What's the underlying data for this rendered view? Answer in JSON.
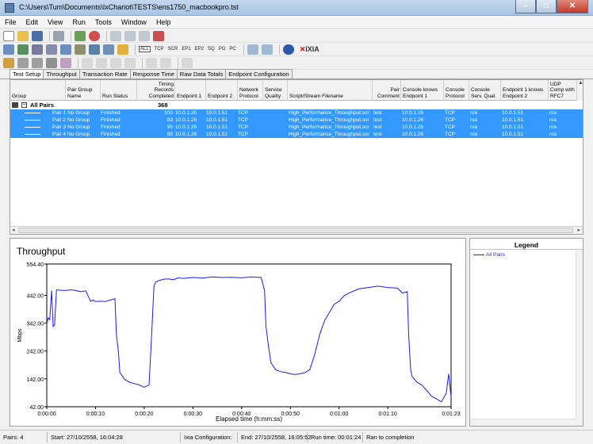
{
  "window": {
    "title": "C:\\Users\\Tum\\Documents\\IxChariot\\TESTS\\ens1750_macbookpro.tst"
  },
  "menu": [
    "File",
    "Edit",
    "View",
    "Run",
    "Tools",
    "Window",
    "Help"
  ],
  "toolbar2_labels": [
    "ALL",
    "TCP",
    "SCR",
    "EP1",
    "EP2",
    "SQ",
    "PG",
    "PC"
  ],
  "brand": "IXIA",
  "tabs": [
    "Test Setup",
    "Throughput",
    "Transaction Rate",
    "Response Time",
    "Raw Data Totals",
    "Endpoint Configuration"
  ],
  "grid": {
    "columns": [
      "Group",
      "Pair Group Name",
      "Run Status",
      "Timing Records Completed",
      "Endpoint 1",
      "Endpoint 2",
      "Network Protocol",
      "Service Quality",
      "Script/Stream Filename",
      "Pair Comment",
      "Console knows Endpoint 1",
      "Console Protocol",
      "Console Serv. Qual.",
      "Endpoint 1 knows Endpoint 2",
      "UDP Comp with RFC7"
    ],
    "all_pairs_label": "All Pairs",
    "all_pairs_total": "368",
    "rows": [
      {
        "pair": "Pair 1",
        "group": "No Group",
        "status": "Finished",
        "records": "100",
        "ep1": "10.0.1.26",
        "ep2": "10.0.1.51",
        "proto": "TCP",
        "script": "High_Performance_Throughput.scr",
        "comment": "test",
        "cke1": "10.0.1.26",
        "cproto": "TCP",
        "csq": "n/a",
        "e1ke2": "10.0.1.51",
        "udp": "n/a"
      },
      {
        "pair": "Pair 2",
        "group": "No Group",
        "status": "Finished",
        "records": "83",
        "ep1": "10.0.1.26",
        "ep2": "10.0.1.51",
        "proto": "TCP",
        "script": "High_Performance_Throughput.scr",
        "comment": "test",
        "cke1": "10.0.1.26",
        "cproto": "TCP",
        "csq": "n/a",
        "e1ke2": "10.0.1.51",
        "udp": "n/a"
      },
      {
        "pair": "Pair 3",
        "group": "No Group",
        "status": "Finished",
        "records": "96",
        "ep1": "10.0.1.26",
        "ep2": "10.0.1.51",
        "proto": "TCP",
        "script": "High_Performance_Throughput.scr",
        "comment": "test",
        "cke1": "10.0.1.26",
        "cproto": "TCP",
        "csq": "n/a",
        "e1ke2": "10.0.1.51",
        "udp": "n/a"
      },
      {
        "pair": "Pair 4",
        "group": "No Group",
        "status": "Finished",
        "records": "89",
        "ep1": "10.0.1.26",
        "ep2": "10.0.1.51",
        "proto": "TCP",
        "script": "High_Performance_Throughput.scr",
        "comment": "test",
        "cke1": "10.0.1.26",
        "cproto": "TCP",
        "csq": "n/a",
        "e1ke2": "10.0.1.51",
        "udp": "n/a"
      }
    ]
  },
  "legend": {
    "title": "Legend",
    "item": "All Pairs"
  },
  "status": {
    "pairs": "Pairs: 4",
    "start": "Start: 27/10/2558, 16:04:28",
    "ixia_config": "Ixia Configuration:",
    "end": "End: 27/10/2558, 16:05:52",
    "runtime": "Run time: 00:01:24",
    "result": "Ran to completion"
  },
  "chart_data": {
    "type": "line",
    "title": "Throughput",
    "xlabel": "Elapsed time (h:mm:ss)",
    "ylabel": "Mbps",
    "x_ticks": [
      "0:00:00",
      "0:00:10",
      "0:00:20",
      "0:00:30",
      "0:00:40",
      "0:00:50",
      "0:01:00",
      "0:01:10",
      "0:01:23"
    ],
    "y_ticks": [
      "42.00",
      "142.00",
      "242.00",
      "342.00",
      "442.00",
      "554.40"
    ],
    "ylim": [
      42,
      554.4
    ],
    "xlim": [
      0,
      83
    ],
    "series": [
      {
        "name": "All Pairs",
        "color": "#1a1aff",
        "x": [
          0,
          0.3,
          0.6,
          1,
          1.3,
          1.6,
          2,
          3,
          4,
          5,
          6,
          7,
          8,
          9,
          9.5,
          10,
          11,
          12,
          13,
          14,
          14.3,
          14.7,
          15,
          16,
          17,
          18,
          19,
          20,
          21,
          21.5,
          22,
          22.4,
          23,
          24,
          25,
          26,
          27,
          28,
          30,
          32,
          34,
          36,
          38,
          40,
          42,
          44,
          44.7,
          45,
          45.5,
          46,
          47,
          48,
          49,
          50,
          51,
          52,
          53,
          54,
          55,
          56,
          57,
          58,
          59,
          60,
          61,
          62,
          64,
          66,
          68,
          70,
          72,
          73,
          74,
          74.3,
          74.7,
          75,
          76,
          77,
          78,
          79,
          80,
          81,
          82,
          82.5,
          83
        ],
        "y": [
          340,
          361,
          355,
          459,
          330,
          335,
          462,
          460,
          460,
          462,
          459,
          455,
          458,
          420,
          425,
          420,
          421,
          420,
          425,
          430,
          300,
          240,
          165,
          140,
          130,
          125,
          120,
          112,
          120,
          290,
          475,
          490,
          495,
          500,
          501,
          498,
          505,
          503,
          506,
          504,
          508,
          506,
          507,
          505,
          508,
          506,
          460,
          330,
          260,
          200,
          175,
          168,
          165,
          160,
          158,
          160,
          165,
          175,
          230,
          300,
          350,
          380,
          410,
          420,
          440,
          450,
          465,
          470,
          475,
          470,
          468,
          450,
          455,
          300,
          175,
          150,
          130,
          120,
          100,
          80,
          70,
          60,
          90,
          160,
          77
        ]
      }
    ]
  }
}
